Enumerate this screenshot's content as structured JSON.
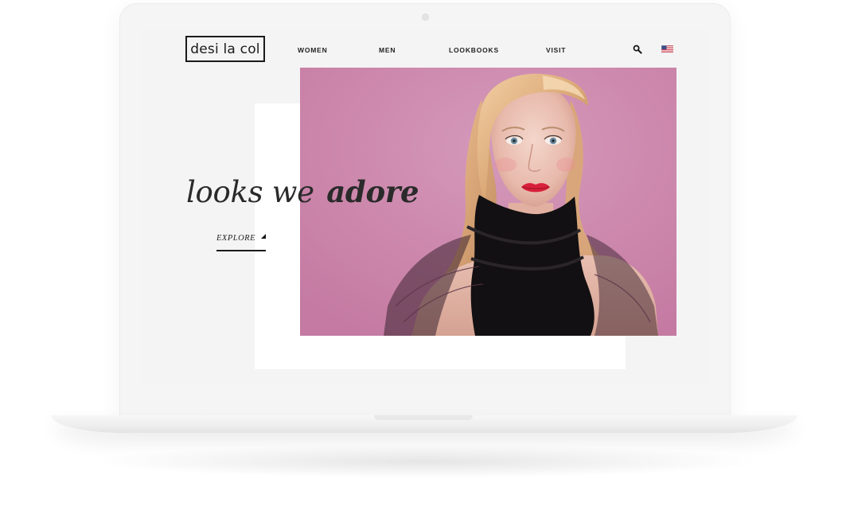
{
  "site": {
    "logo_text": "desi la col"
  },
  "nav": {
    "items": [
      {
        "label": "WOMEN"
      },
      {
        "label": "MEN"
      },
      {
        "label": "LOOKBOOKS"
      },
      {
        "label": "VISIT"
      }
    ],
    "search_icon": "search-icon",
    "flag_icon": "us-flag-icon"
  },
  "hero": {
    "headline_part1": "looks",
    "headline_part2": "we",
    "headline_part3": "adore",
    "cta_label": "EXPLORE",
    "image_subject": "model-portrait",
    "background_color": "#cc88ac"
  },
  "colors": {
    "screen_bg": "#f4f4f4",
    "text": "#1a1a1a",
    "accent_lips": "#d8203a"
  }
}
